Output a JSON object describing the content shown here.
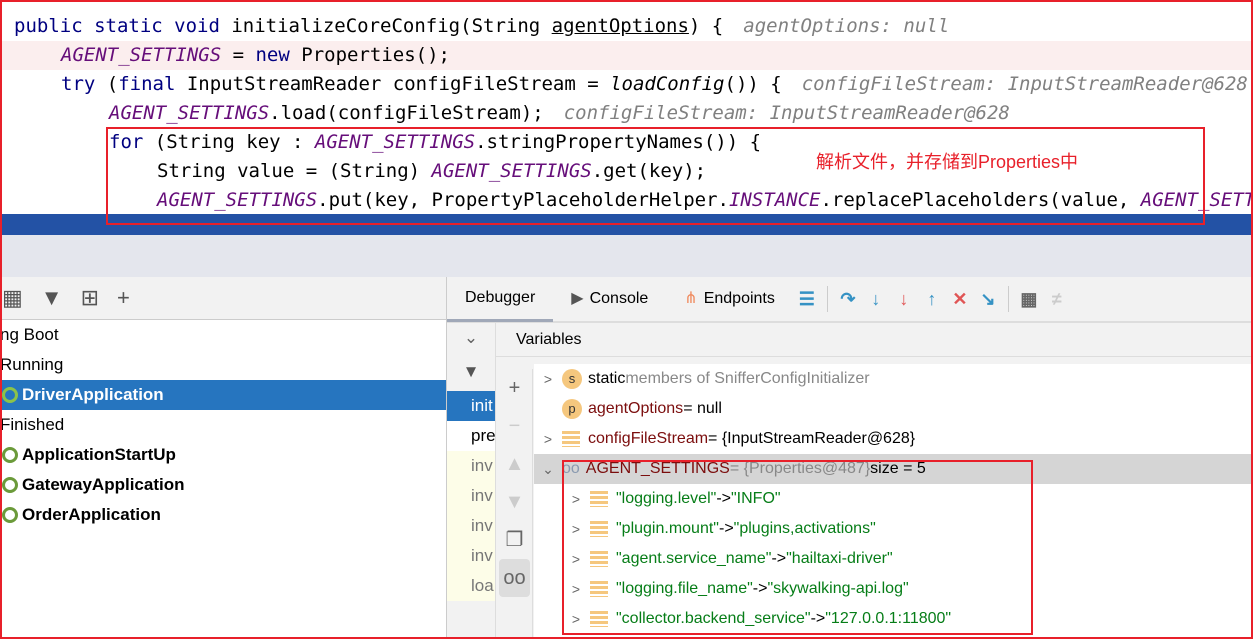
{
  "code": {
    "l1": {
      "kw": "public static void ",
      "name": "initializeCoreConfig",
      "p1": "(String ",
      "param": "agentOptions",
      "p2": ") {",
      "hint": "agentOptions: null"
    },
    "l2": {
      "fld": "AGENT_SETTINGS",
      "rest": " = ",
      "kw": "new",
      "rest2": " Properties();"
    },
    "l3": {
      "kw": "try",
      "rest": " (",
      "kw2": "final",
      "rest2": " InputStreamReader configFileStream = ",
      "call": "loadConfig",
      "rest3": "()) {",
      "hint": "configFileStream: InputStreamReader@628"
    },
    "l4": {
      "fld": "AGENT_SETTINGS",
      "rest": ".load(configFileStream);",
      "hint": "configFileStream: InputStreamReader@628"
    },
    "l5": {
      "kw": "for",
      "rest": " (String key : ",
      "fld": "AGENT_SETTINGS",
      "rest2": ".stringPropertyNames()) {"
    },
    "l6": {
      "rest": "String value = (String) ",
      "fld": "AGENT_SETTINGS",
      "rest2": ".get(key);"
    },
    "l7": {
      "fld": "AGENT_SETTINGS",
      "rest": ".put(key, PropertyPlaceholderHelper.",
      "fld2": "INSTANCE",
      "rest2": ".replacePlaceholders(value, ",
      "fld3": "AGENT_SETTINGS"
    }
  },
  "annotation": "解析文件，并存储到Properties中",
  "services": [
    {
      "label": "ng Boot",
      "bold": false
    },
    {
      "label": "Running",
      "bold": false
    },
    {
      "label": "DriverApplication",
      "bold": true,
      "selected": true
    },
    {
      "label": "Finished",
      "bold": false
    },
    {
      "label": "ApplicationStartUp",
      "bold": true
    },
    {
      "label": "GatewayApplication",
      "bold": true
    },
    {
      "label": "OrderApplication",
      "bold": true
    }
  ],
  "tabs": [
    {
      "label": "Debugger",
      "icon": "debugger"
    },
    {
      "label": "Console",
      "icon": "console-icon"
    },
    {
      "label": "Endpoints",
      "icon": "endpoints-icon"
    }
  ],
  "frames": [
    "init",
    "pre",
    "inv",
    "inv",
    "inv",
    "inv",
    "loa"
  ],
  "variables_header": "Variables",
  "variables": [
    {
      "icon": "s",
      "name": "static",
      "rest": " members of SnifferConfigInitializer",
      "expand": true
    },
    {
      "icon": "p",
      "name": "agentOptions",
      "rest": " = null",
      "expand": false
    },
    {
      "icon": "lines",
      "name": "configFileStream",
      "rest": " = {InputStreamReader@628}",
      "expand": true
    },
    {
      "icon": "watch",
      "name": "AGENT_SETTINGS",
      "rest": " = {Properties@487}",
      "extra": "  size = 5",
      "expand": true,
      "open": true
    }
  ],
  "entries": [
    {
      "key": "\"logging.level\"",
      "value": "\"INFO\""
    },
    {
      "key": "\"plugin.mount\"",
      "value": "\"plugins,activations\""
    },
    {
      "key": "\"agent.service_name\"",
      "value": "\"hailtaxi-driver\""
    },
    {
      "key": "\"logging.file_name\"",
      "value": "\"skywalking-api.log\""
    },
    {
      "key": "\"collector.backend_service\"",
      "value": "\"127.0.0.1:11800\""
    }
  ],
  "arrow": " -> ",
  "colors": {
    "accent": "#2675bf",
    "annotation": "#e8202a",
    "string": "#067d17"
  }
}
